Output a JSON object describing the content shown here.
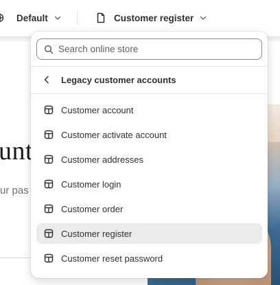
{
  "topbar": {
    "theme_selector": {
      "label": "Default",
      "icon": "globe-icon"
    },
    "template_selector": {
      "label": "Customer register",
      "icon": "page-icon"
    }
  },
  "preview": {
    "heading_fragment": "unt",
    "subtext_fragment": "ur pas"
  },
  "dropdown": {
    "search": {
      "placeholder": "Search online store",
      "value": ""
    },
    "back": {
      "label": "Legacy customer accounts"
    },
    "items": [
      {
        "label": "Customer account",
        "icon": "template-icon",
        "selected": false
      },
      {
        "label": "Customer activate account",
        "icon": "template-icon",
        "selected": false
      },
      {
        "label": "Customer addresses",
        "icon": "template-icon",
        "selected": false
      },
      {
        "label": "Customer login",
        "icon": "template-icon",
        "selected": false
      },
      {
        "label": "Customer order",
        "icon": "template-icon",
        "selected": false
      },
      {
        "label": "Customer register",
        "icon": "template-icon",
        "selected": true
      },
      {
        "label": "Customer reset password",
        "icon": "template-icon",
        "selected": false
      }
    ]
  },
  "colors": {
    "selected_bg": "#ebebeb",
    "text": "#303030",
    "border": "#8a8a8a"
  }
}
